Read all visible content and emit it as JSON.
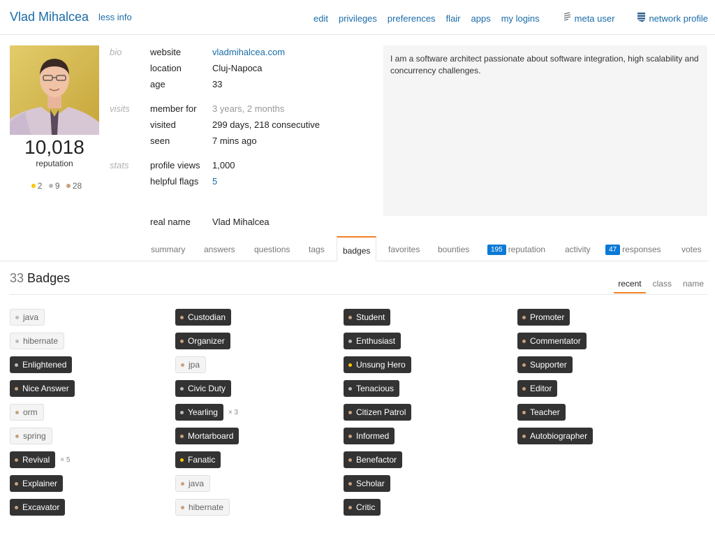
{
  "header": {
    "user_name": "Vlad Mihalcea",
    "less_info": "less info",
    "links": [
      {
        "label": "edit",
        "icon": ""
      },
      {
        "label": "privileges",
        "icon": ""
      },
      {
        "label": "preferences",
        "icon": ""
      },
      {
        "label": "flair",
        "icon": ""
      },
      {
        "label": "apps",
        "icon": ""
      },
      {
        "label": "my logins",
        "icon": ""
      },
      {
        "label": "meta user",
        "icon": "meta-icon"
      },
      {
        "label": "network profile",
        "icon": "network-icon"
      }
    ]
  },
  "profile": {
    "reputation": "10,018",
    "reputation_label": "reputation",
    "gold": "2",
    "silver": "9",
    "bronze": "28",
    "bio_label": "bio",
    "visits_label": "visits",
    "stats_label": "stats",
    "website_label": "website",
    "website": "vladmihalcea.com",
    "location_label": "location",
    "location": "Cluj-Napoca",
    "age_label": "age",
    "age": "33",
    "member_for_label": "member for",
    "member_for": "3 years, 2 months",
    "visited_label": "visited",
    "visited": "299 days, 218 consecutive",
    "seen_label": "seen",
    "seen": "7 mins ago",
    "profile_views_label": "profile views",
    "profile_views": "1,000",
    "helpful_flags_label": "helpful flags",
    "helpful_flags": "5",
    "real_name_label": "real name",
    "real_name": "Vlad Mihalcea",
    "about": "I am a software architect passionate about software integration, high scalability and concurrency challenges."
  },
  "tabs": {
    "summary": "summary",
    "answers": "answers",
    "questions": "questions",
    "tags": "tags",
    "badges": "badges",
    "favorites": "favorites",
    "bounties": "bounties",
    "reputation_count": "195",
    "reputation": "reputation",
    "activity": "activity",
    "responses_count": "47",
    "responses": "responses",
    "votes": "votes"
  },
  "badges_section": {
    "count": "33",
    "title": "Badges",
    "sort_recent": "recent",
    "sort_class": "class",
    "sort_name": "name",
    "columns": [
      [
        {
          "name": "java",
          "kind": "tag",
          "class": "silver",
          "mult": ""
        },
        {
          "name": "hibernate",
          "kind": "tag",
          "class": "silver",
          "mult": ""
        },
        {
          "name": "Enlightened",
          "kind": "dark",
          "class": "silver",
          "mult": ""
        },
        {
          "name": "Nice Answer",
          "kind": "dark",
          "class": "bronze",
          "mult": ""
        },
        {
          "name": "orm",
          "kind": "tag",
          "class": "bronze",
          "mult": ""
        },
        {
          "name": "spring",
          "kind": "tag",
          "class": "bronze",
          "mult": ""
        },
        {
          "name": "Revival",
          "kind": "dark",
          "class": "bronze",
          "mult": "× 5"
        },
        {
          "name": "Explainer",
          "kind": "dark",
          "class": "bronze",
          "mult": ""
        },
        {
          "name": "Excavator",
          "kind": "dark",
          "class": "bronze",
          "mult": ""
        }
      ],
      [
        {
          "name": "Custodian",
          "kind": "dark",
          "class": "bronze",
          "mult": ""
        },
        {
          "name": "Organizer",
          "kind": "dark",
          "class": "bronze",
          "mult": ""
        },
        {
          "name": "jpa",
          "kind": "tag",
          "class": "bronze",
          "mult": ""
        },
        {
          "name": "Civic Duty",
          "kind": "dark",
          "class": "silver",
          "mult": ""
        },
        {
          "name": "Yearling",
          "kind": "dark",
          "class": "silver",
          "mult": "× 3"
        },
        {
          "name": "Mortarboard",
          "kind": "dark",
          "class": "bronze",
          "mult": ""
        },
        {
          "name": "Fanatic",
          "kind": "dark",
          "class": "gold",
          "mult": ""
        },
        {
          "name": "java",
          "kind": "tag",
          "class": "bronze",
          "mult": ""
        },
        {
          "name": "hibernate",
          "kind": "tag",
          "class": "bronze",
          "mult": ""
        }
      ],
      [
        {
          "name": "Student",
          "kind": "dark",
          "class": "bronze",
          "mult": ""
        },
        {
          "name": "Enthusiast",
          "kind": "dark",
          "class": "silver",
          "mult": ""
        },
        {
          "name": "Unsung Hero",
          "kind": "dark",
          "class": "gold",
          "mult": ""
        },
        {
          "name": "Tenacious",
          "kind": "dark",
          "class": "silver",
          "mult": ""
        },
        {
          "name": "Citizen Patrol",
          "kind": "dark",
          "class": "bronze",
          "mult": ""
        },
        {
          "name": "Informed",
          "kind": "dark",
          "class": "bronze",
          "mult": ""
        },
        {
          "name": "Benefactor",
          "kind": "dark",
          "class": "bronze",
          "mult": ""
        },
        {
          "name": "Scholar",
          "kind": "dark",
          "class": "bronze",
          "mult": ""
        },
        {
          "name": "Critic",
          "kind": "dark",
          "class": "bronze",
          "mult": ""
        }
      ],
      [
        {
          "name": "Promoter",
          "kind": "dark",
          "class": "bronze",
          "mult": ""
        },
        {
          "name": "Commentator",
          "kind": "dark",
          "class": "bronze",
          "mult": ""
        },
        {
          "name": "Supporter",
          "kind": "dark",
          "class": "bronze",
          "mult": ""
        },
        {
          "name": "Editor",
          "kind": "dark",
          "class": "bronze",
          "mult": ""
        },
        {
          "name": "Teacher",
          "kind": "dark",
          "class": "bronze",
          "mult": ""
        },
        {
          "name": "Autobiographer",
          "kind": "dark",
          "class": "bronze",
          "mult": ""
        }
      ]
    ]
  },
  "colors": {
    "link": "#1a6ca8",
    "accent_tab": "#f48024",
    "count_badge": "#0a7ad6",
    "badge_bg": "#333333",
    "gold": "#f9c700",
    "silver": "#b4b8bc",
    "bronze": "#c8a17e"
  }
}
